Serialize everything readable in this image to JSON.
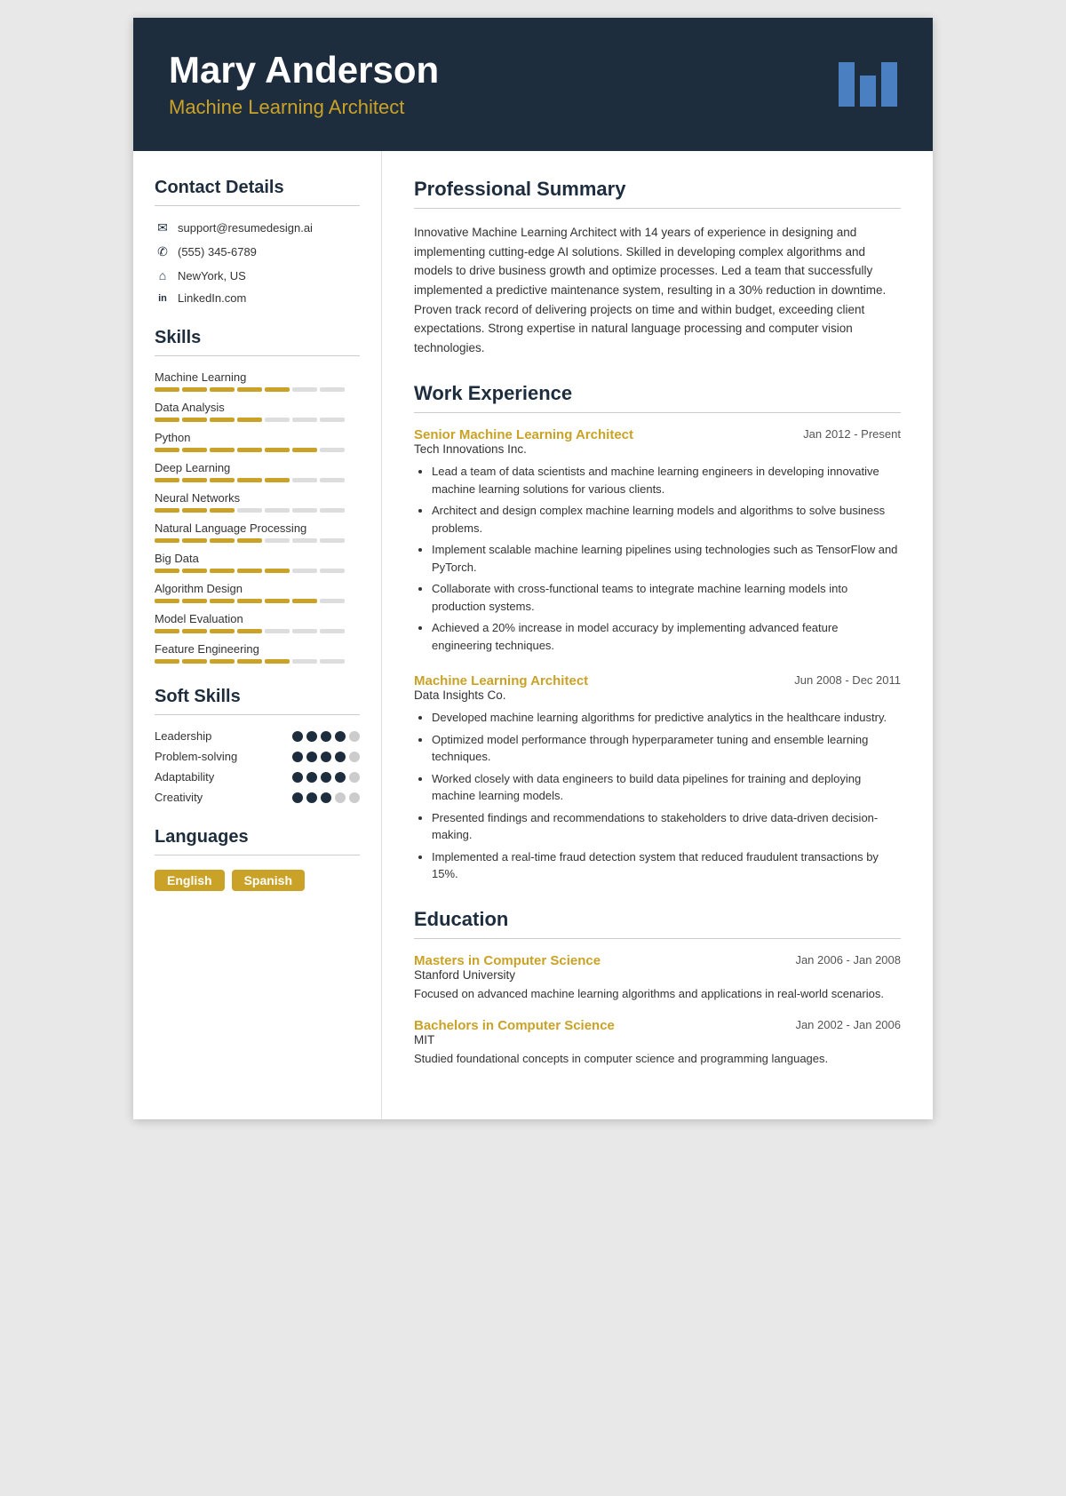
{
  "header": {
    "name": "Mary Anderson",
    "title": "Machine Learning Architect"
  },
  "sidebar": {
    "contact_section_title": "Contact Details",
    "contact": [
      {
        "icon": "✉",
        "value": "support@resumedesign.ai"
      },
      {
        "icon": "✆",
        "value": "(555) 345-6789"
      },
      {
        "icon": "⌂",
        "value": "NewYork, US"
      },
      {
        "icon": "in",
        "value": "LinkedIn.com"
      }
    ],
    "skills_section_title": "Skills",
    "skills": [
      {
        "name": "Machine Learning",
        "filled": 5,
        "total": 7
      },
      {
        "name": "Data Analysis",
        "filled": 4,
        "total": 7
      },
      {
        "name": "Python",
        "filled": 6,
        "total": 7
      },
      {
        "name": "Deep Learning",
        "filled": 5,
        "total": 7
      },
      {
        "name": "Neural Networks",
        "filled": 3,
        "total": 7
      },
      {
        "name": "Natural Language Processing",
        "filled": 4,
        "total": 7
      },
      {
        "name": "Big Data",
        "filled": 5,
        "total": 7
      },
      {
        "name": "Algorithm Design",
        "filled": 6,
        "total": 7
      },
      {
        "name": "Model Evaluation",
        "filled": 4,
        "total": 7
      },
      {
        "name": "Feature Engineering",
        "filled": 5,
        "total": 7
      }
    ],
    "soft_skills_section_title": "Soft Skills",
    "soft_skills": [
      {
        "name": "Leadership",
        "filled": 4,
        "total": 5
      },
      {
        "name": "Problem-solving",
        "filled": 4,
        "total": 5
      },
      {
        "name": "Adaptability",
        "filled": 4,
        "total": 5
      },
      {
        "name": "Creativity",
        "filled": 3,
        "total": 5
      }
    ],
    "languages_section_title": "Languages",
    "languages": [
      "English",
      "Spanish"
    ]
  },
  "main": {
    "summary_section_title": "Professional Summary",
    "summary": "Innovative Machine Learning Architect with 14 years of experience in designing and implementing cutting-edge AI solutions. Skilled in developing complex algorithms and models to drive business growth and optimize processes. Led a team that successfully implemented a predictive maintenance system, resulting in a 30% reduction in downtime. Proven track record of delivering projects on time and within budget, exceeding client expectations. Strong expertise in natural language processing and computer vision technologies.",
    "work_section_title": "Work Experience",
    "jobs": [
      {
        "title": "Senior Machine Learning Architect",
        "date": "Jan 2012 - Present",
        "company": "Tech Innovations Inc.",
        "bullets": [
          "Lead a team of data scientists and machine learning engineers in developing innovative machine learning solutions for various clients.",
          "Architect and design complex machine learning models and algorithms to solve business problems.",
          "Implement scalable machine learning pipelines using technologies such as TensorFlow and PyTorch.",
          "Collaborate with cross-functional teams to integrate machine learning models into production systems.",
          "Achieved a 20% increase in model accuracy by implementing advanced feature engineering techniques."
        ]
      },
      {
        "title": "Machine Learning Architect",
        "date": "Jun 2008 - Dec 2011",
        "company": "Data Insights Co.",
        "bullets": [
          "Developed machine learning algorithms for predictive analytics in the healthcare industry.",
          "Optimized model performance through hyperparameter tuning and ensemble learning techniques.",
          "Worked closely with data engineers to build data pipelines for training and deploying machine learning models.",
          "Presented findings and recommendations to stakeholders to drive data-driven decision-making.",
          "Implemented a real-time fraud detection system that reduced fraudulent transactions by 15%."
        ]
      }
    ],
    "education_section_title": "Education",
    "education": [
      {
        "degree": "Masters in Computer Science",
        "date": "Jan 2006 - Jan 2008",
        "school": "Stanford University",
        "desc": "Focused on advanced machine learning algorithms and applications in real-world scenarios."
      },
      {
        "degree": "Bachelors in Computer Science",
        "date": "Jan 2002 - Jan 2006",
        "school": "MIT",
        "desc": "Studied foundational concepts in computer science and programming languages."
      }
    ]
  }
}
